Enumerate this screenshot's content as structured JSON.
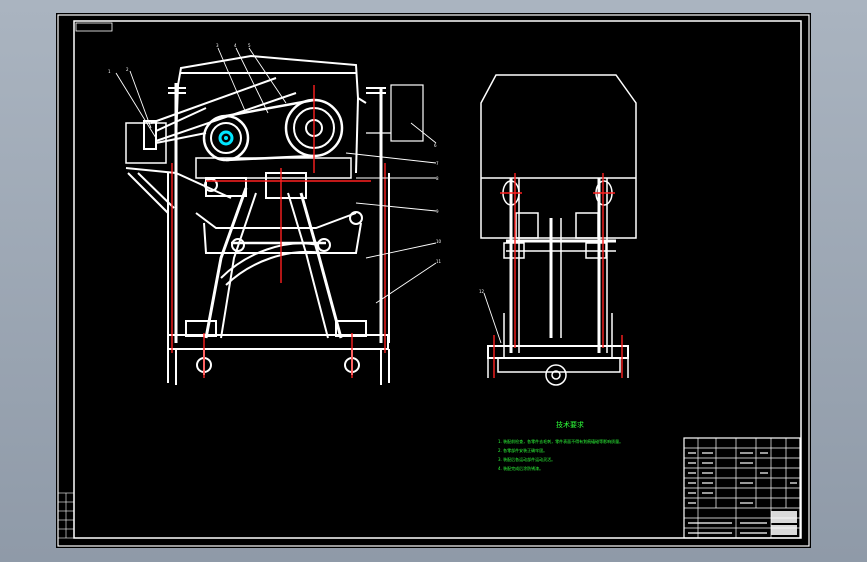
{
  "drawing": {
    "title_tag": "",
    "tech_requirements": {
      "title": "技术要求",
      "lines": [
        "1. 装配前检查，各零件去毛刺，零件表面不得有划痕磕碰等影响质量。",
        "2. 各零部件安装正确牢固。",
        "3. 装配后各运动部件运动灵活。",
        "4. 装配完成后涂防锈漆。"
      ]
    },
    "leader_numbers": [
      "1",
      "2",
      "3",
      "4",
      "5",
      "6",
      "7",
      "8",
      "9",
      "10",
      "11",
      "12",
      "13",
      "14"
    ],
    "colors": {
      "background": "#000000",
      "line": "#ffffff",
      "accent_red": "#ff2020",
      "accent_cyan": "#00e5ff",
      "text_green": "#2eff3a",
      "screen_bg": "#9aa5b2"
    }
  }
}
